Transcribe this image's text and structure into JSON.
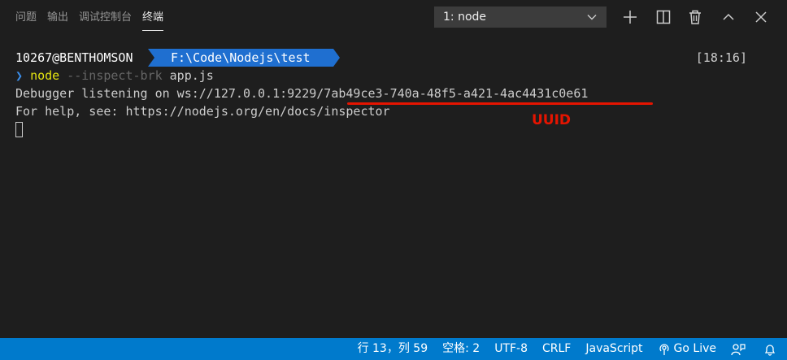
{
  "panel": {
    "tabs": [
      {
        "label": "问题"
      },
      {
        "label": "输出"
      },
      {
        "label": "调试控制台"
      },
      {
        "label": "终端"
      }
    ],
    "terminal_select": "1: node",
    "icons": [
      "plus-icon",
      "split-icon",
      "trash-icon",
      "chevron-up-icon",
      "close-icon"
    ]
  },
  "terminal": {
    "user": "10267@BENTHOMSON",
    "path": "F:\\Code\\Nodejs\\test",
    "time": "[18:16]",
    "prompt_char": "❯",
    "cmd": "node",
    "flag": "--inspect-brk",
    "arg": "app.js",
    "debug_prefix": "Debugger listening on ws://127.0.0.1:9229",
    "debug_uuid": "/7ab49ce3-740a-48f5-a421-4ac4431c0e61",
    "help_line": "For help, see: https://nodejs.org/en/docs/inspector",
    "annotation": "UUID"
  },
  "colors": {
    "path_bg": "#1f6fd0",
    "annotation": "#e51400",
    "statusbar": "#007acc"
  },
  "statusbar": {
    "position": "行 13，列 59",
    "indent": "空格: 2",
    "encoding": "UTF-8",
    "eol": "CRLF",
    "language": "JavaScript",
    "golive": "Go Live"
  }
}
